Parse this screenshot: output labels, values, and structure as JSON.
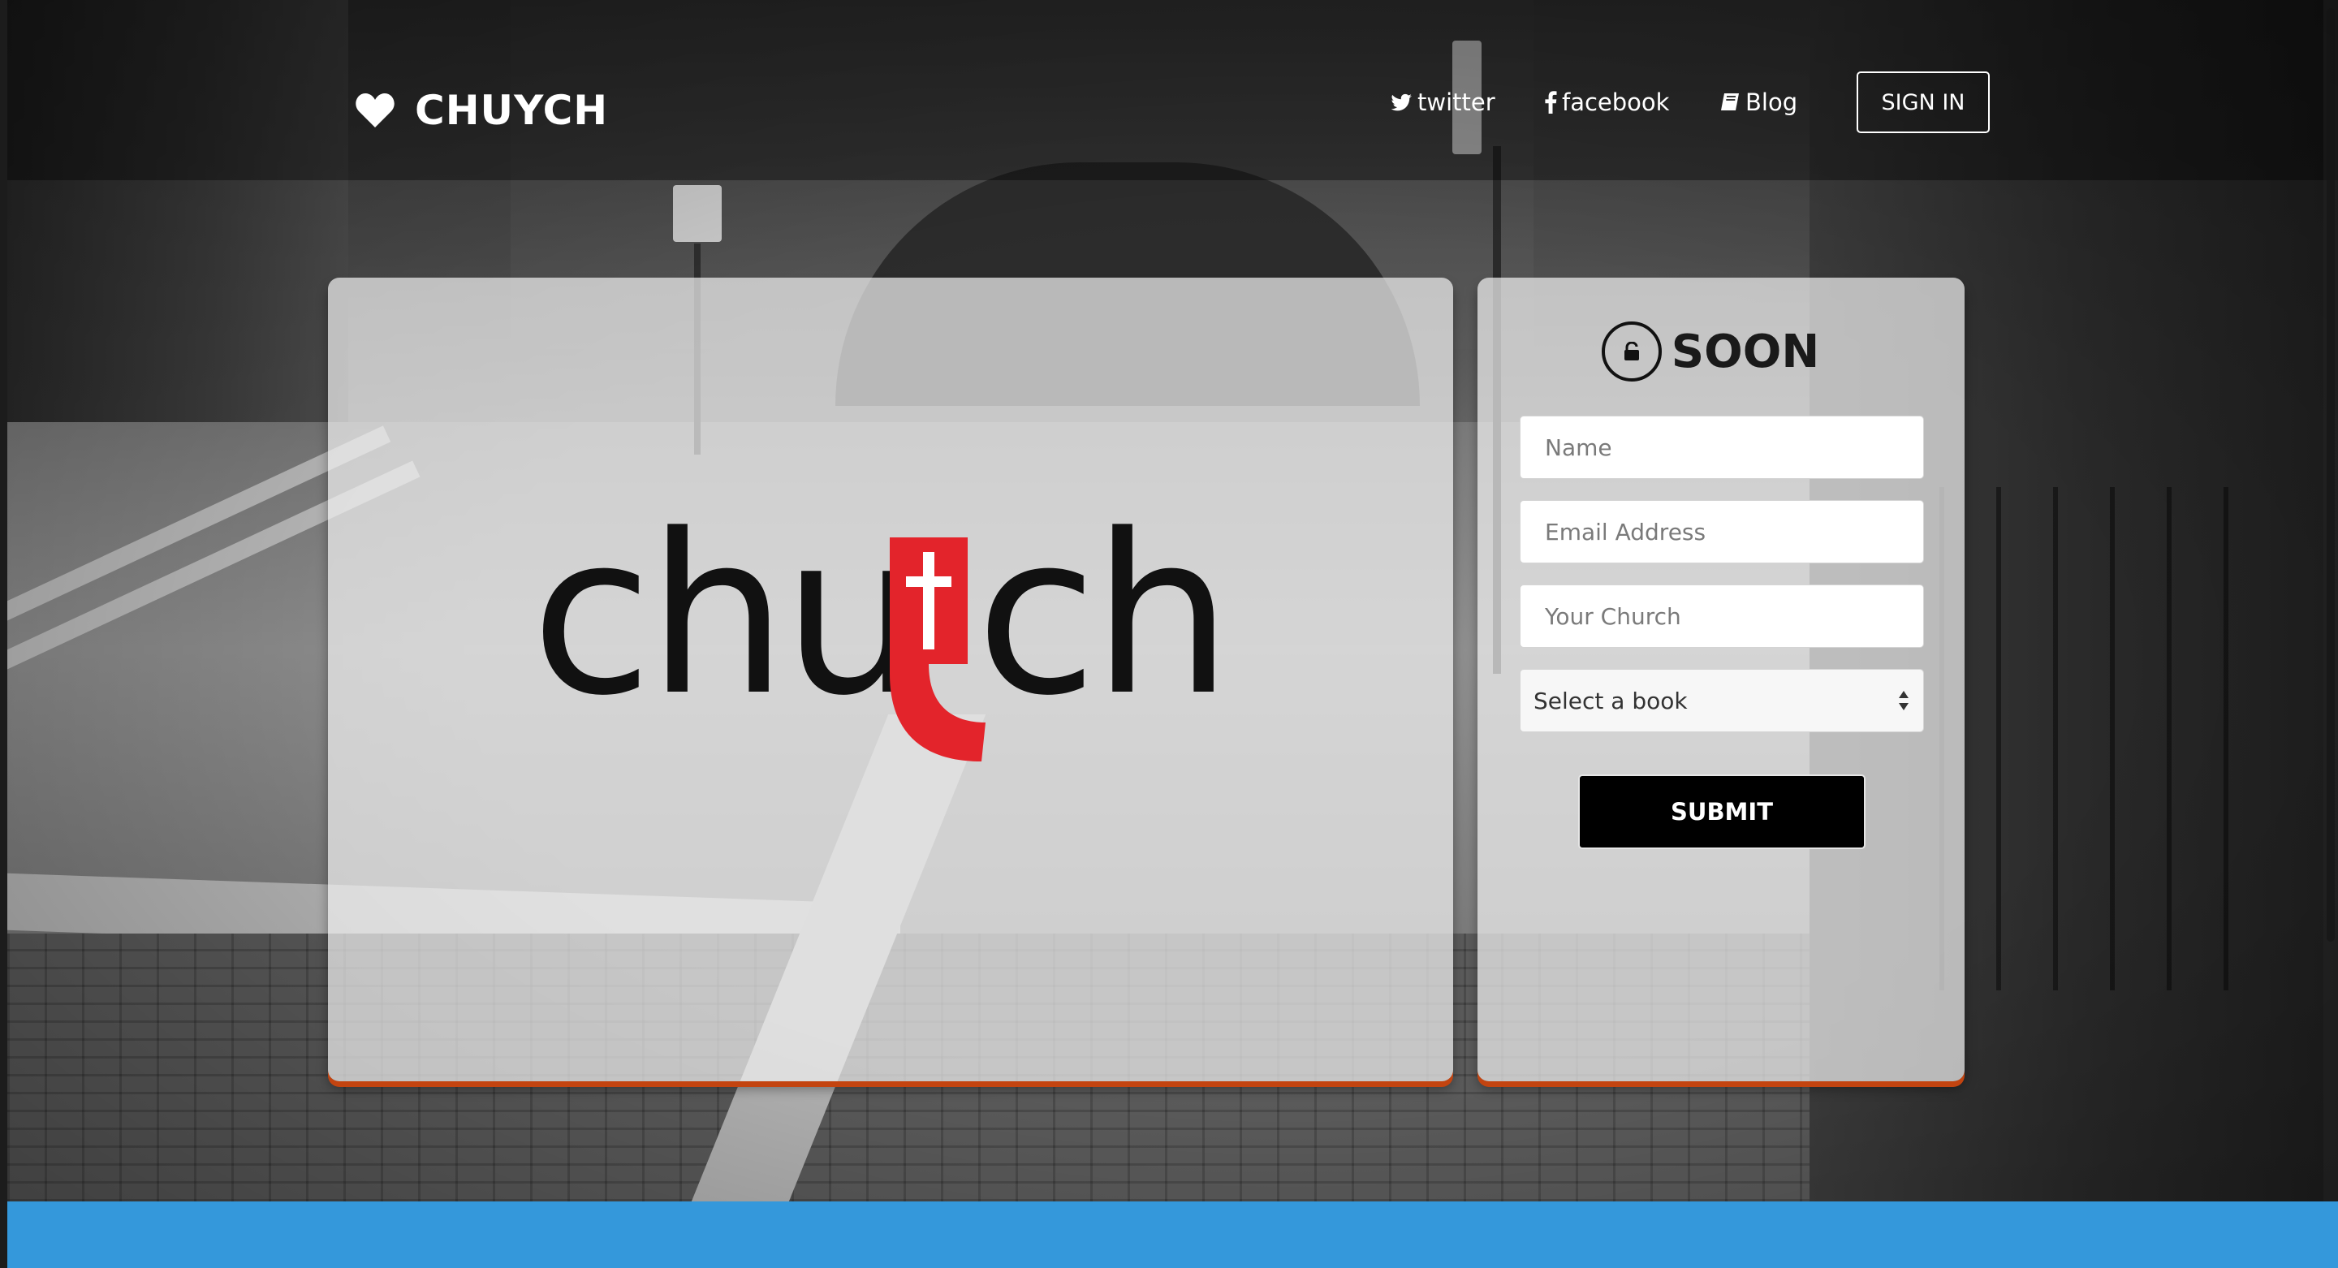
{
  "nav": {
    "brand": "CHUYCH",
    "brand_icon": "heart-icon",
    "links": [
      {
        "label": "twitter",
        "icon": "twitter-icon"
      },
      {
        "label": "facebook",
        "icon": "facebook-icon"
      },
      {
        "label": "Blog",
        "icon": "book-icon"
      }
    ],
    "signin_label": "SIGN IN"
  },
  "logo": {
    "wordmark": "chuych",
    "accent_letter": "y",
    "accent_color": "#e3242b",
    "text_color": "#111111"
  },
  "form": {
    "title": "SOON",
    "title_icon": "lock-icon",
    "name_placeholder": "Name",
    "email_placeholder": "Email Address",
    "church_placeholder": "Your Church",
    "select_value": "Select a book",
    "submit_label": "SUBMIT"
  },
  "colors": {
    "panel_underline": "#c34410",
    "bottom_band": "#3498db",
    "submit_bg": "#000000"
  }
}
